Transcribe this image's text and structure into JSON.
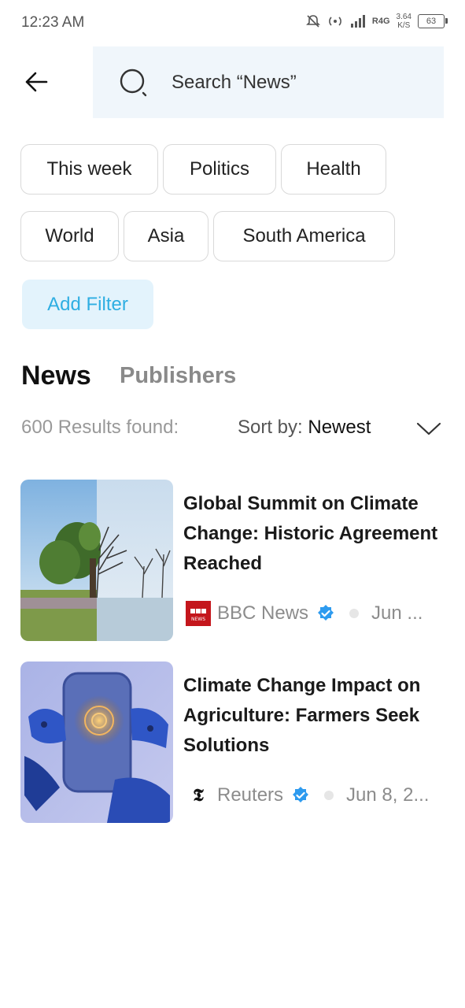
{
  "status_bar": {
    "time": "12:23 AM",
    "network": "R4G",
    "speed_value": "3.64",
    "speed_unit": "K/S",
    "battery": "63"
  },
  "search": {
    "placeholder": "Search “News”"
  },
  "filters": {
    "chips": [
      "This week",
      "Politics",
      "Health",
      "World",
      "Asia",
      "South America"
    ],
    "add_filter_label": "Add Filter"
  },
  "tabs": {
    "active": "News",
    "inactive": "Publishers"
  },
  "results": {
    "count_text": "600 Results found:",
    "sort_label": "Sort by:",
    "sort_value": "Newest"
  },
  "articles": [
    {
      "title": "Global Summit on Climate Change: Historic Agreement Reached",
      "publisher": "BBC News",
      "date": "Jun ...",
      "logo_text": "BBC NEWS",
      "verified": true
    },
    {
      "title": "Climate Change Impact on Agriculture: Farmers Seek Solutions",
      "publisher": "Reuters",
      "date": "Jun 8, 2...",
      "logo_text": "𝕿",
      "verified": true
    }
  ],
  "colors": {
    "accent": "#2eaee2",
    "search_bg": "#f0f6fb",
    "verified": "#2e9bef",
    "bbc_red": "#c4161c"
  }
}
